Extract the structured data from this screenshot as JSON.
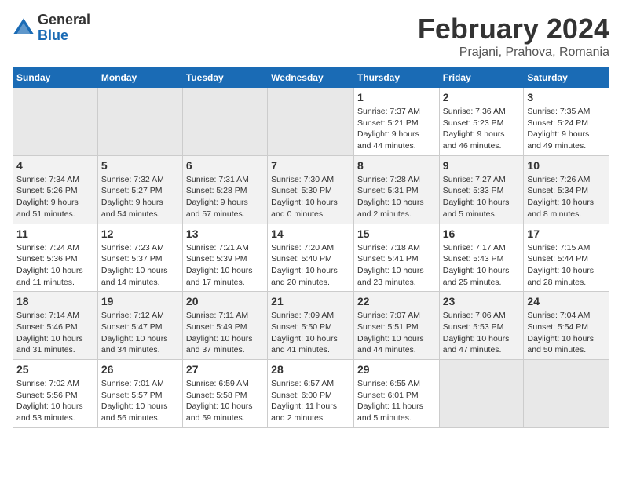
{
  "logo": {
    "general": "General",
    "blue": "Blue"
  },
  "title": "February 2024",
  "subtitle": "Prajani, Prahova, Romania",
  "weekdays": [
    "Sunday",
    "Monday",
    "Tuesday",
    "Wednesday",
    "Thursday",
    "Friday",
    "Saturday"
  ],
  "weeks": [
    [
      {
        "day": "",
        "info": ""
      },
      {
        "day": "",
        "info": ""
      },
      {
        "day": "",
        "info": ""
      },
      {
        "day": "",
        "info": ""
      },
      {
        "day": "1",
        "info": "Sunrise: 7:37 AM\nSunset: 5:21 PM\nDaylight: 9 hours\nand 44 minutes."
      },
      {
        "day": "2",
        "info": "Sunrise: 7:36 AM\nSunset: 5:23 PM\nDaylight: 9 hours\nand 46 minutes."
      },
      {
        "day": "3",
        "info": "Sunrise: 7:35 AM\nSunset: 5:24 PM\nDaylight: 9 hours\nand 49 minutes."
      }
    ],
    [
      {
        "day": "4",
        "info": "Sunrise: 7:34 AM\nSunset: 5:26 PM\nDaylight: 9 hours\nand 51 minutes."
      },
      {
        "day": "5",
        "info": "Sunrise: 7:32 AM\nSunset: 5:27 PM\nDaylight: 9 hours\nand 54 minutes."
      },
      {
        "day": "6",
        "info": "Sunrise: 7:31 AM\nSunset: 5:28 PM\nDaylight: 9 hours\nand 57 minutes."
      },
      {
        "day": "7",
        "info": "Sunrise: 7:30 AM\nSunset: 5:30 PM\nDaylight: 10 hours\nand 0 minutes."
      },
      {
        "day": "8",
        "info": "Sunrise: 7:28 AM\nSunset: 5:31 PM\nDaylight: 10 hours\nand 2 minutes."
      },
      {
        "day": "9",
        "info": "Sunrise: 7:27 AM\nSunset: 5:33 PM\nDaylight: 10 hours\nand 5 minutes."
      },
      {
        "day": "10",
        "info": "Sunrise: 7:26 AM\nSunset: 5:34 PM\nDaylight: 10 hours\nand 8 minutes."
      }
    ],
    [
      {
        "day": "11",
        "info": "Sunrise: 7:24 AM\nSunset: 5:36 PM\nDaylight: 10 hours\nand 11 minutes."
      },
      {
        "day": "12",
        "info": "Sunrise: 7:23 AM\nSunset: 5:37 PM\nDaylight: 10 hours\nand 14 minutes."
      },
      {
        "day": "13",
        "info": "Sunrise: 7:21 AM\nSunset: 5:39 PM\nDaylight: 10 hours\nand 17 minutes."
      },
      {
        "day": "14",
        "info": "Sunrise: 7:20 AM\nSunset: 5:40 PM\nDaylight: 10 hours\nand 20 minutes."
      },
      {
        "day": "15",
        "info": "Sunrise: 7:18 AM\nSunset: 5:41 PM\nDaylight: 10 hours\nand 23 minutes."
      },
      {
        "day": "16",
        "info": "Sunrise: 7:17 AM\nSunset: 5:43 PM\nDaylight: 10 hours\nand 25 minutes."
      },
      {
        "day": "17",
        "info": "Sunrise: 7:15 AM\nSunset: 5:44 PM\nDaylight: 10 hours\nand 28 minutes."
      }
    ],
    [
      {
        "day": "18",
        "info": "Sunrise: 7:14 AM\nSunset: 5:46 PM\nDaylight: 10 hours\nand 31 minutes."
      },
      {
        "day": "19",
        "info": "Sunrise: 7:12 AM\nSunset: 5:47 PM\nDaylight: 10 hours\nand 34 minutes."
      },
      {
        "day": "20",
        "info": "Sunrise: 7:11 AM\nSunset: 5:49 PM\nDaylight: 10 hours\nand 37 minutes."
      },
      {
        "day": "21",
        "info": "Sunrise: 7:09 AM\nSunset: 5:50 PM\nDaylight: 10 hours\nand 41 minutes."
      },
      {
        "day": "22",
        "info": "Sunrise: 7:07 AM\nSunset: 5:51 PM\nDaylight: 10 hours\nand 44 minutes."
      },
      {
        "day": "23",
        "info": "Sunrise: 7:06 AM\nSunset: 5:53 PM\nDaylight: 10 hours\nand 47 minutes."
      },
      {
        "day": "24",
        "info": "Sunrise: 7:04 AM\nSunset: 5:54 PM\nDaylight: 10 hours\nand 50 minutes."
      }
    ],
    [
      {
        "day": "25",
        "info": "Sunrise: 7:02 AM\nSunset: 5:56 PM\nDaylight: 10 hours\nand 53 minutes."
      },
      {
        "day": "26",
        "info": "Sunrise: 7:01 AM\nSunset: 5:57 PM\nDaylight: 10 hours\nand 56 minutes."
      },
      {
        "day": "27",
        "info": "Sunrise: 6:59 AM\nSunset: 5:58 PM\nDaylight: 10 hours\nand 59 minutes."
      },
      {
        "day": "28",
        "info": "Sunrise: 6:57 AM\nSunset: 6:00 PM\nDaylight: 11 hours\nand 2 minutes."
      },
      {
        "day": "29",
        "info": "Sunrise: 6:55 AM\nSunset: 6:01 PM\nDaylight: 11 hours\nand 5 minutes."
      },
      {
        "day": "",
        "info": ""
      },
      {
        "day": "",
        "info": ""
      }
    ]
  ]
}
